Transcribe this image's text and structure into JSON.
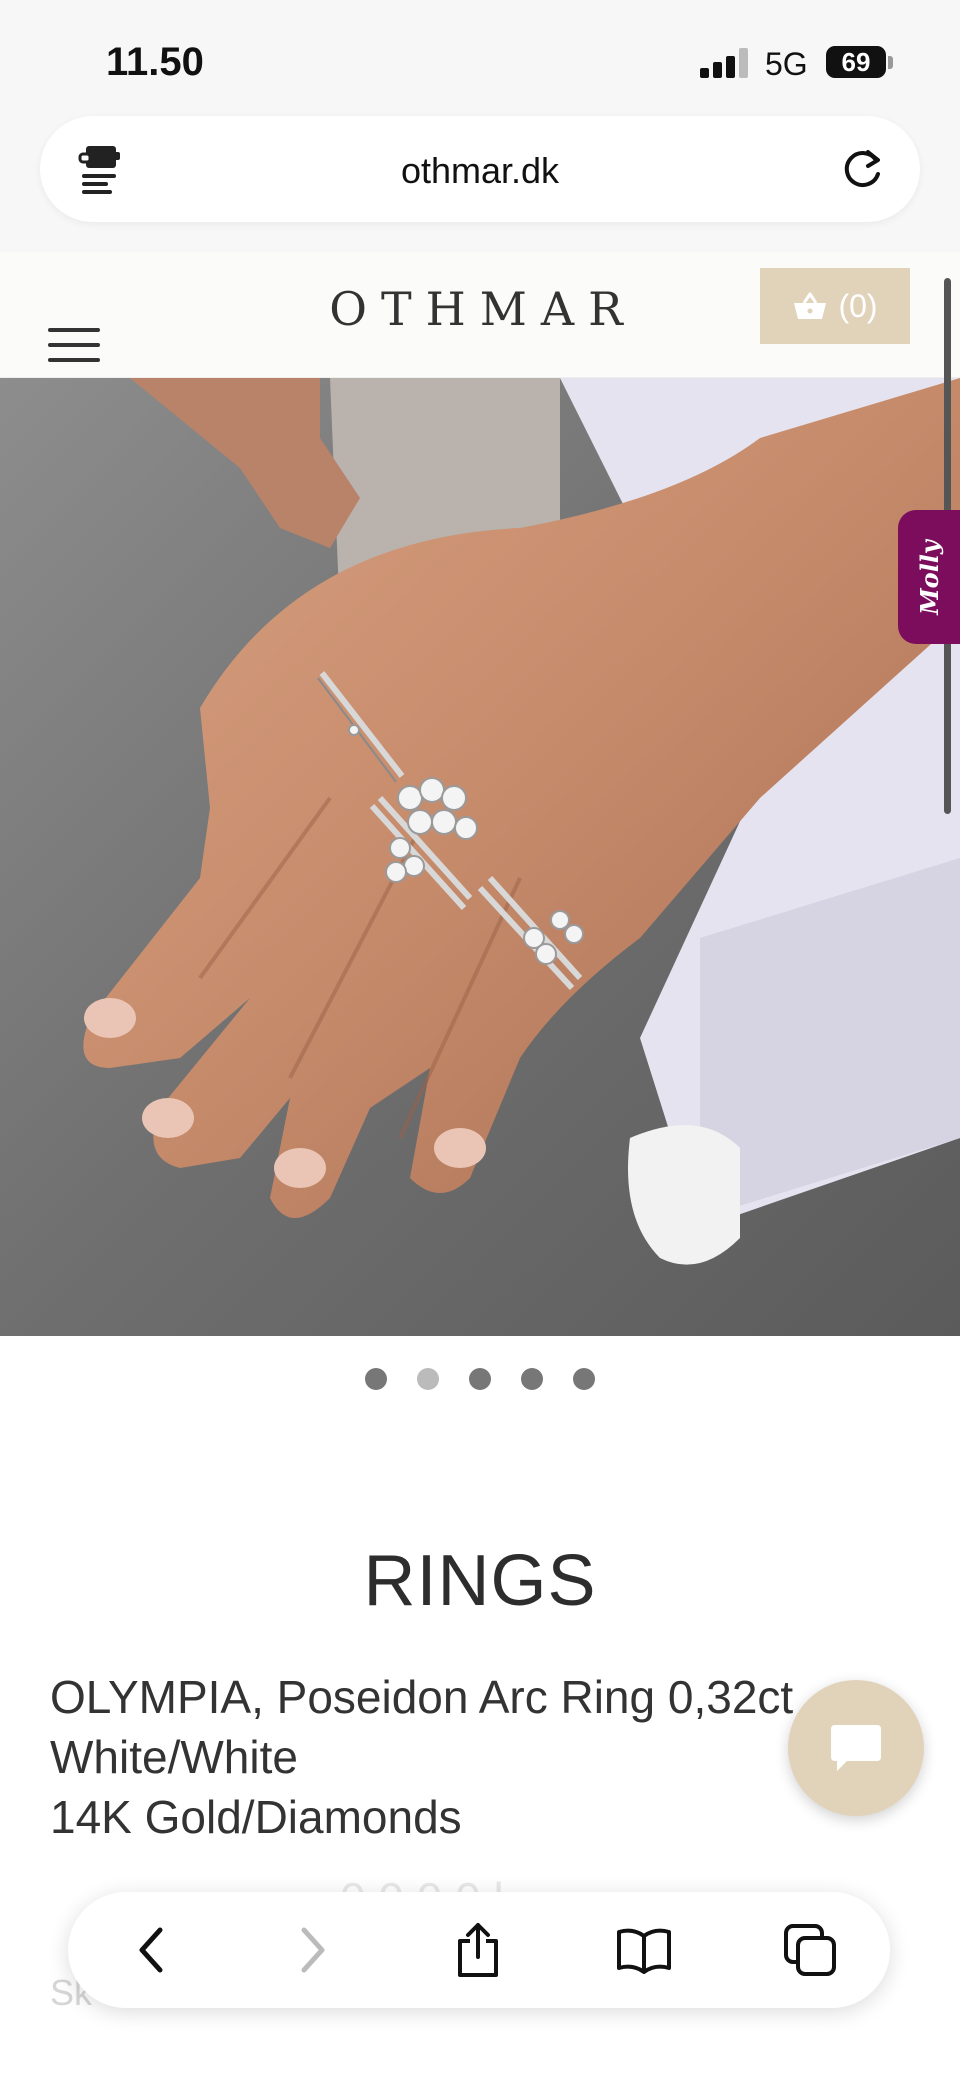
{
  "status_bar": {
    "time": "11.50",
    "network": "5G",
    "battery": "69"
  },
  "browser": {
    "url": "othmar.dk"
  },
  "site": {
    "logo": "OTHMAR",
    "cart_label": "(0)"
  },
  "molly": {
    "label": "Molly"
  },
  "carousel": {
    "count": 5,
    "active_index": 1
  },
  "product": {
    "category": "RINGS",
    "name": "OLYMPIA, Poseidon Arc Ring 0,32ct",
    "variant": "White/White",
    "material": "14K Gold/Diamonds",
    "price_partial": "0 0 0 0 l",
    "shipping_partial": "Sk"
  },
  "colors": {
    "accent": "#e1d3ba",
    "molly": "#7b0d5c"
  },
  "icons": {
    "extension": "extension-icon",
    "reload": "reload-icon",
    "menu": "hamburger-menu-icon",
    "cart": "basket-icon",
    "chat": "chat-bubble-icon",
    "back": "chevron-left-icon",
    "forward": "chevron-right-icon",
    "share": "share-icon",
    "bookmarks": "book-icon",
    "tabs": "tabs-icon"
  }
}
